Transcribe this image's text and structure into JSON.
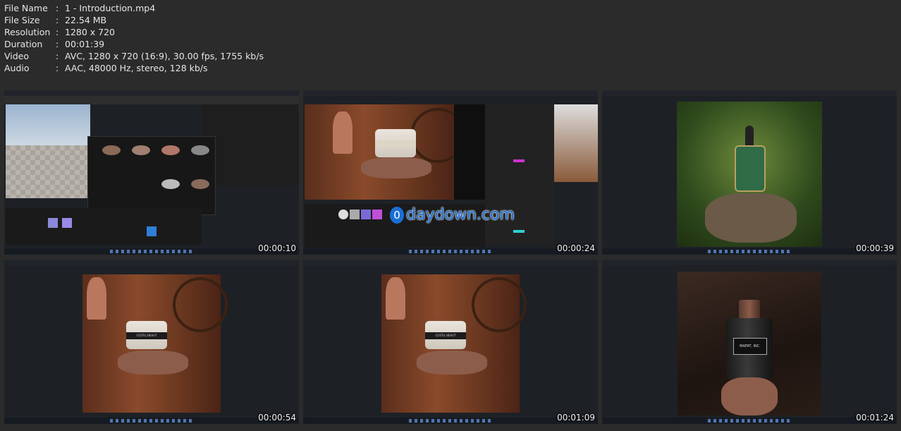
{
  "metadata": [
    {
      "key": "File Name",
      "value": "1 - Introduction.mp4"
    },
    {
      "key": "File Size",
      "value": "22.54 MB"
    },
    {
      "key": "Resolution",
      "value": "1280 x 720"
    },
    {
      "key": "Duration",
      "value": "00:01:39"
    },
    {
      "key": "Video",
      "value": "AVC, 1280 x 720 (16:9), 30.00 fps, 1755 kb/s"
    },
    {
      "key": "Audio",
      "value": "AAC, 48000 Hz, stereo, 128 kb/s"
    }
  ],
  "separator": ":",
  "thumbnails": [
    {
      "timestamp": "00:00:10",
      "scene": "unreal-editor-content-browser"
    },
    {
      "timestamp": "00:00:24",
      "scene": "material-editor-jar"
    },
    {
      "timestamp": "00:00:39",
      "scene": "green-serum-bottle-render"
    },
    {
      "timestamp": "00:00:54",
      "scene": "cosmetic-jar-render"
    },
    {
      "timestamp": "00:01:09",
      "scene": "cosmetic-jar-render"
    },
    {
      "timestamp": "00:01:24",
      "scene": "black-perfume-bottle-render"
    }
  ],
  "watermark": {
    "logo": "0",
    "text": "daydown.com"
  },
  "product_labels": {
    "jar": "COSTIL BEAUT",
    "perfume": "MAFAT, INC."
  }
}
